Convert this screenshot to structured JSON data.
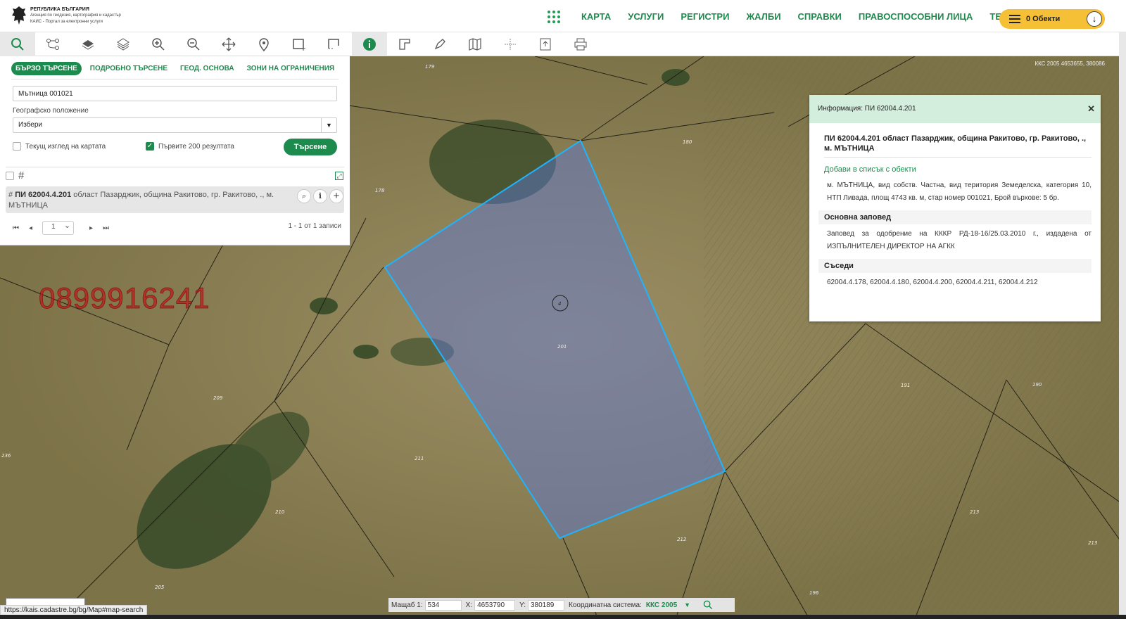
{
  "header": {
    "logo": {
      "line1": "РЕПУБЛИКА БЪЛГАРИЯ",
      "line2": "Агенция по геодезия, картография и кадастър",
      "line3": "КАИС - Портал за електронни услуги"
    },
    "nav": [
      "КАРТА",
      "УСЛУГИ",
      "РЕГИСТРИ",
      "ЖАЛБИ",
      "СПРАВКИ",
      "ПРАВОСПОСОБНИ ЛИЦА",
      "ТЕСТ"
    ],
    "objects_label": "0 Обекти"
  },
  "toolbar": {
    "icons": [
      "search-icon",
      "route-icon",
      "layers-icon",
      "layers-stack-icon",
      "zoom-in-icon",
      "zoom-out-icon",
      "pan-icon",
      "location-pin-icon",
      "select-rectangle-icon",
      "select-area-icon",
      "info-icon",
      "measure-icon",
      "draw-icon",
      "map-icon",
      "crosshair-icon",
      "export-icon",
      "print-icon"
    ]
  },
  "search": {
    "tabs": [
      "БЪРЗО ТЪРСЕНЕ",
      "ПОДРОБНО ТЪРСЕНЕ",
      "ГЕОД. ОСНОВА",
      "ЗОНИ НА ОГРАНИЧЕНИЯ"
    ],
    "query": "Мътница 001021",
    "geo_label": "Географско положение",
    "geo_value": "Избери",
    "current_view_label": "Текущ изглед на картата",
    "first200_label": "Първите 200 резултата",
    "button": "Търсене",
    "result": {
      "id": "ПИ 62004.4.201",
      "desc": " област Пазарджик, община Ракитово, гр. Ракитово, ., м. МЪТНИЦА"
    },
    "page": "1",
    "count": "1 - 1 от 1 записи"
  },
  "info": {
    "header": "Информация: ПИ 62004.4.201",
    "title": "ПИ 62004.4.201 област Пазарджик, община Ракитово, гр. Ракитово, ., м. МЪТНИЦА",
    "add_link": "Добави в списък с обекти",
    "body": "м. МЪТНИЦА, вид собств. Частна, вид територия Земеделска, категория 10, НТП Ливада, площ 4743 кв. м, стар номер 001021, Брой върхове: 5 бр.",
    "sec1": "Основна заповед",
    "sec1_text": "Заповед за одобрение на КККР РД-18-16/25.03.2010 г., издадена от ИЗПЪЛНИТЕЛЕН ДИРЕКТОР НА АГКК",
    "sec2": "Съседи",
    "sec2_text": "62004.4.178, 62004.4.180, 62004.4.200, 62004.4.211, 62004.4.212"
  },
  "coords": {
    "scale_label": "Мащаб 1:",
    "scale": "534",
    "x_label": "X:",
    "x": "4653790",
    "y_label": "Y:",
    "y": "380189",
    "system_label": "Координатна система:",
    "system": "ККС 2005"
  },
  "map": {
    "watermark": "0899916241",
    "crs": "ККС 2005 4653655, 380086",
    "parcel_labels": [
      "179",
      "180",
      "178",
      "4",
      "201",
      "209",
      "211",
      "210",
      "212",
      "191",
      "190",
      "213",
      "236",
      "196",
      "205"
    ]
  },
  "status_url": "https://kais.cadastre.bg/bg/Map#map-search",
  "colors": {
    "accent": "#1e8b4e",
    "highlight": "#f5c035",
    "parcel": "#1eb4ff"
  }
}
